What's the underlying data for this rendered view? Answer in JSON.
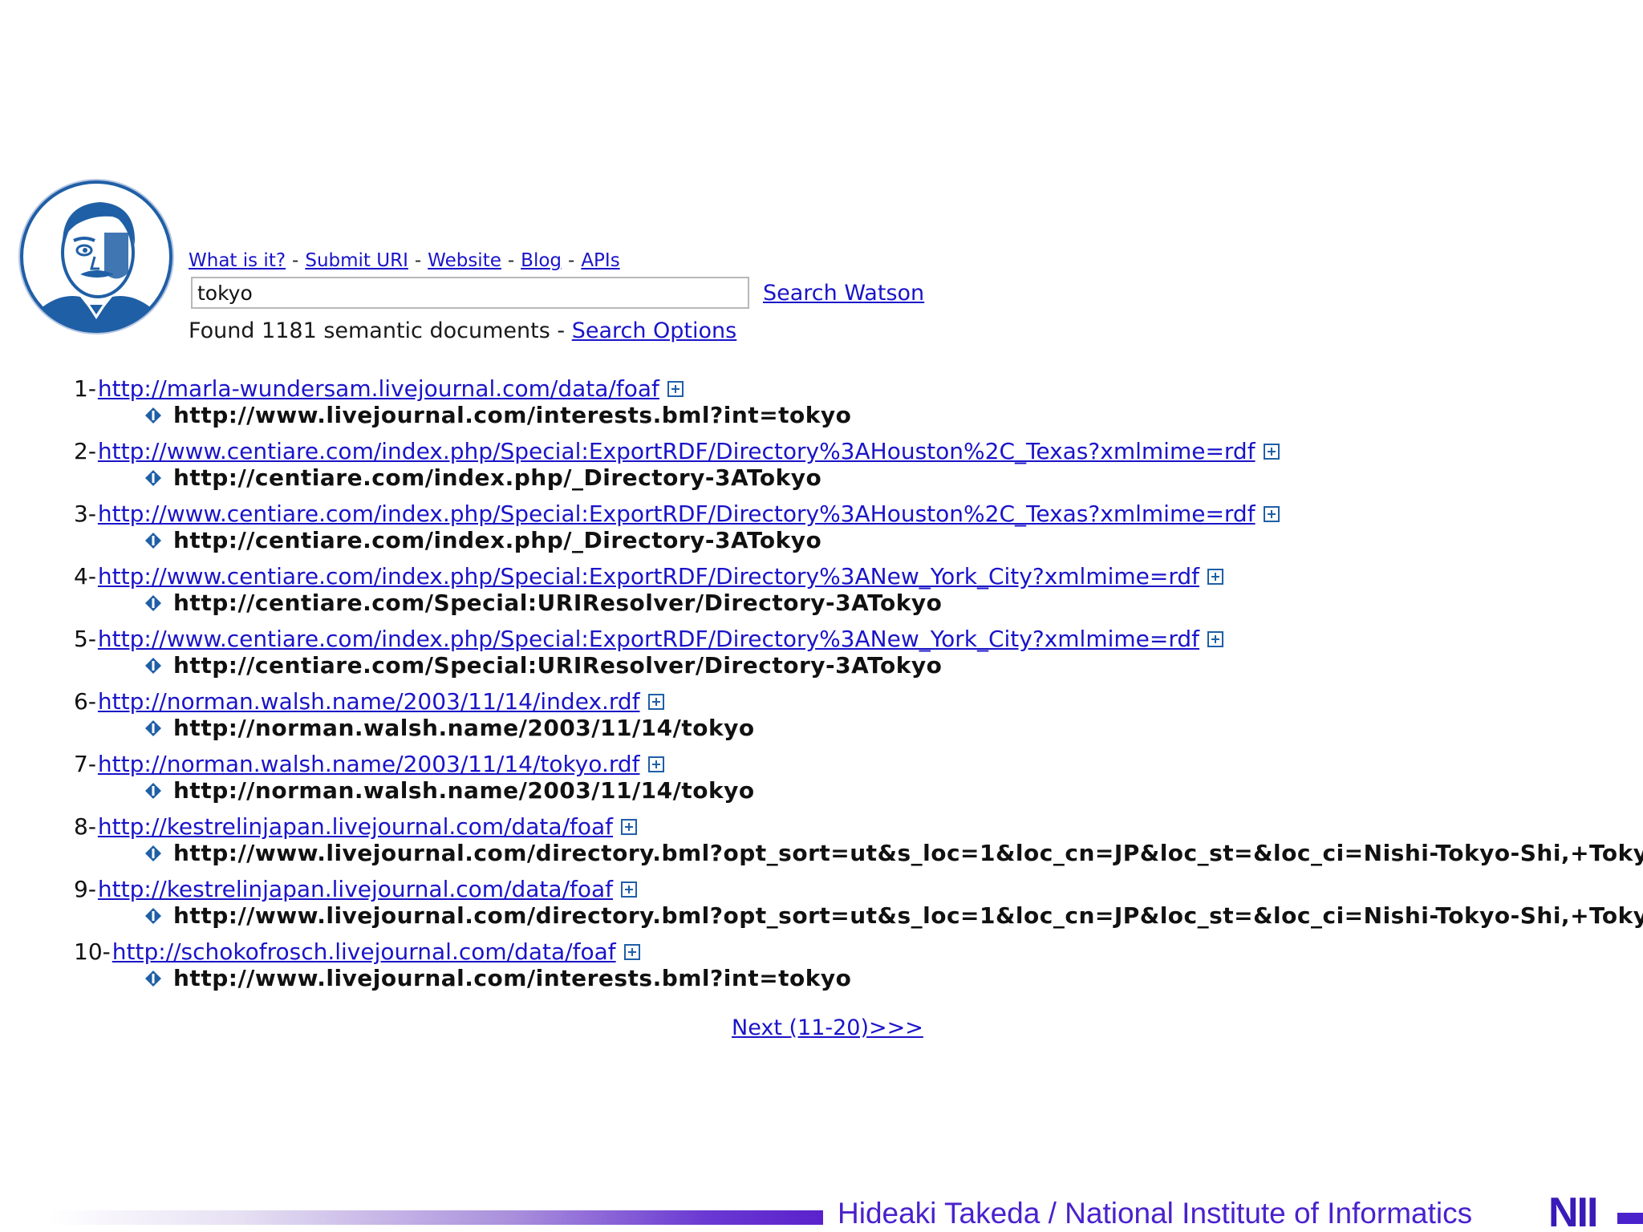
{
  "header": {
    "nav": [
      {
        "label": "What is it?"
      },
      {
        "label": "Submit URI"
      },
      {
        "label": "Website"
      },
      {
        "label": "Blog"
      },
      {
        "label": "APIs"
      }
    ],
    "nav_separator": "-",
    "search": {
      "value": "tokyo",
      "button_label": "Search Watson"
    },
    "found": {
      "text": "Found 1181 semantic documents -",
      "options_label": "Search Options"
    }
  },
  "results": [
    {
      "num": "1-",
      "url": "http://marla-wundersam.livejournal.com/data/foaf",
      "match": "http://www.livejournal.com/interests.bml?int=tokyo"
    },
    {
      "num": "2-",
      "url": "http://www.centiare.com/index.php/Special:ExportRDF/Directory%3AHouston%2C_Texas?xmlmime=rdf",
      "match": "http://centiare.com/index.php/_Directory-3ATokyo"
    },
    {
      "num": "3-",
      "url": "http://www.centiare.com/index.php/Special:ExportRDF/Directory%3AHouston%2C_Texas?xmlmime=rdf",
      "match": "http://centiare.com/index.php/_Directory-3ATokyo"
    },
    {
      "num": "4-",
      "url": "http://www.centiare.com/index.php/Special:ExportRDF/Directory%3ANew_York_City?xmlmime=rdf",
      "match": "http://centiare.com/Special:URIResolver/Directory-3ATokyo"
    },
    {
      "num": "5-",
      "url": "http://www.centiare.com/index.php/Special:ExportRDF/Directory%3ANew_York_City?xmlmime=rdf",
      "match": "http://centiare.com/Special:URIResolver/Directory-3ATokyo"
    },
    {
      "num": "6-",
      "url": "http://norman.walsh.name/2003/11/14/index.rdf",
      "match": "http://norman.walsh.name/2003/11/14/tokyo"
    },
    {
      "num": "7-",
      "url": "http://norman.walsh.name/2003/11/14/tokyo.rdf",
      "match": "http://norman.walsh.name/2003/11/14/tokyo"
    },
    {
      "num": "8-",
      "url": "http://kestrelinjapan.livejournal.com/data/foaf",
      "match": "http://www.livejournal.com/directory.bml?opt_sort=ut&s_loc=1&loc_cn=JP&loc_st=&loc_ci=Nishi-Tokyo-Shi,+Tokyo"
    },
    {
      "num": "9-",
      "url": "http://kestrelinjapan.livejournal.com/data/foaf",
      "match": "http://www.livejournal.com/directory.bml?opt_sort=ut&s_loc=1&loc_cn=JP&loc_st=&loc_ci=Nishi-Tokyo-Shi,+Tokyo"
    },
    {
      "num": "10-",
      "url": "http://schokofrosch.livejournal.com/data/foaf",
      "match": "http://www.livejournal.com/interests.bml?int=tokyo"
    }
  ],
  "pagination": {
    "next_label": "Next (11-20)>>>"
  },
  "footer": {
    "credit": "Hideaki Takeda / National Institute of Informatics",
    "logo_text": "NII"
  },
  "colors": {
    "link": "#1a14c8",
    "icon_blue": "#1f5fa6",
    "footer_purple": "#4a22cc"
  }
}
